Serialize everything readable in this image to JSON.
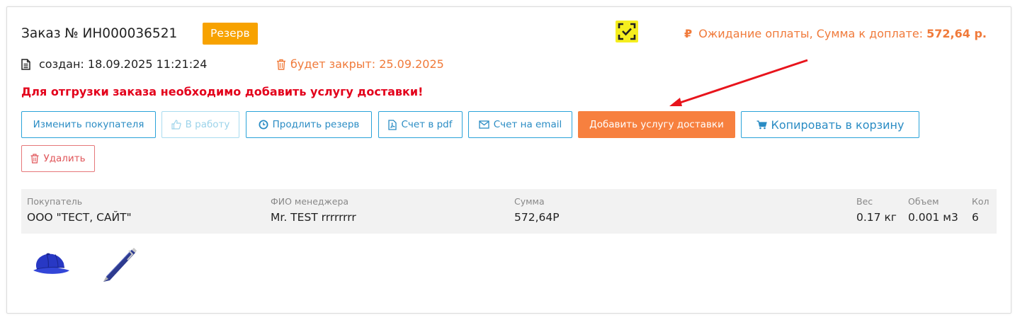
{
  "order": {
    "title": "Заказ № ИН000036521",
    "status_badge": "Резерв",
    "payment_status_label": "Ожидание оплаты, Сумма к доплате:",
    "payment_amount": "572,64 р.",
    "created": "создан: 18.09.2025 11:21:24",
    "closes": "будет закрыт: 25.09.2025",
    "warning": "Для отгрузки заказа необходимо добавить услугу доставки!"
  },
  "buttons": {
    "change_buyer": "Изменить покупателя",
    "to_work": "В работу",
    "extend_reserve": "Продлить резерв",
    "invoice_pdf": "Счет в pdf",
    "invoice_email": "Счет на email",
    "add_delivery": "Добавить услугу доставки",
    "copy_to_cart": "Копировать в корзину",
    "delete": "Удалить"
  },
  "info": {
    "buyer_label": "Покупатель",
    "buyer_value": "ООО \"ТЕСТ, САЙТ\"",
    "manager_label": "ФИО менеджера",
    "manager_value": "Mr. TEST rrrrrrrr",
    "sum_label": "Сумма",
    "sum_value": "572,64Р",
    "weight_label": "Вес",
    "weight_value": "0.17 кг",
    "volume_label": "Объем",
    "volume_value": "0.001 м3",
    "qty_label": "Кол",
    "qty_value": "6"
  },
  "products": [
    {
      "icon": "blue-cap-icon"
    },
    {
      "icon": "blue-pen-icon"
    }
  ],
  "colors": {
    "accent_orange": "#f7803f",
    "badge_orange": "#f7a200",
    "link_blue": "#2a8cc4",
    "warning_red": "#e3001b",
    "annotation_red": "#e8141c"
  }
}
